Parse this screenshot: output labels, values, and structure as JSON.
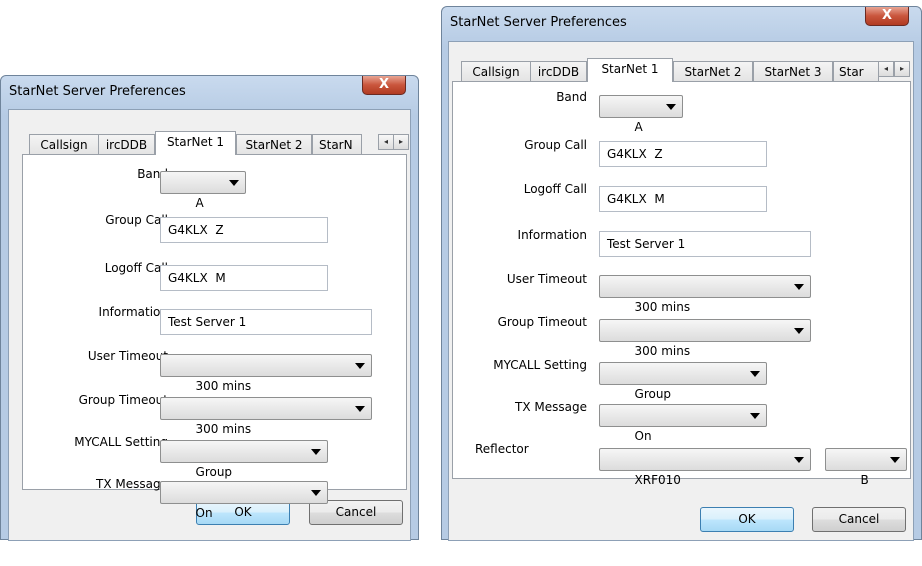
{
  "window_left": {
    "title": "StarNet Server Preferences",
    "close_glyph": "X",
    "tabs": [
      "Callsign",
      "ircDDB",
      "StarNet 1",
      "StarNet 2",
      "StarN"
    ],
    "active_tab": "StarNet 1",
    "labels": {
      "band": "Band",
      "group_call": "Group Call",
      "logoff_call": "Logoff Call",
      "information": "Information",
      "user_timeout": "User Timeout",
      "group_timeout": "Group Timeout",
      "mycall_setting": "MYCALL Setting",
      "tx_message": "TX Message"
    },
    "values": {
      "band": "A",
      "group_call": "G4KLX  Z",
      "logoff_call": "G4KLX  M",
      "information": "Test Server 1",
      "user_timeout": "300 mins",
      "group_timeout": "300 mins",
      "mycall_setting": "Group",
      "tx_message": "On"
    },
    "ok_label": "OK",
    "cancel_label": "Cancel"
  },
  "window_right": {
    "title": "StarNet Server Preferences",
    "close_glyph": "X",
    "tabs": [
      "Callsign",
      "ircDDB",
      "StarNet 1",
      "StarNet 2",
      "StarNet 3",
      "Star"
    ],
    "active_tab": "StarNet 1",
    "labels": {
      "band": "Band",
      "group_call": "Group Call",
      "logoff_call": "Logoff Call",
      "information": "Information",
      "user_timeout": "User Timeout",
      "group_timeout": "Group Timeout",
      "mycall_setting": "MYCALL Setting",
      "tx_message": "TX Message",
      "reflector": "Reflector"
    },
    "values": {
      "band": "A",
      "group_call": "G4KLX  Z",
      "logoff_call": "G4KLX  M",
      "information": "Test Server 1",
      "user_timeout": "300 mins",
      "group_timeout": "300 mins",
      "mycall_setting": "Group",
      "tx_message": "On",
      "reflector": "XRF010",
      "reflector_module": "B"
    },
    "ok_label": "OK",
    "cancel_label": "Cancel"
  },
  "scroll_glyphs": {
    "left": "◂",
    "right": "▸"
  }
}
